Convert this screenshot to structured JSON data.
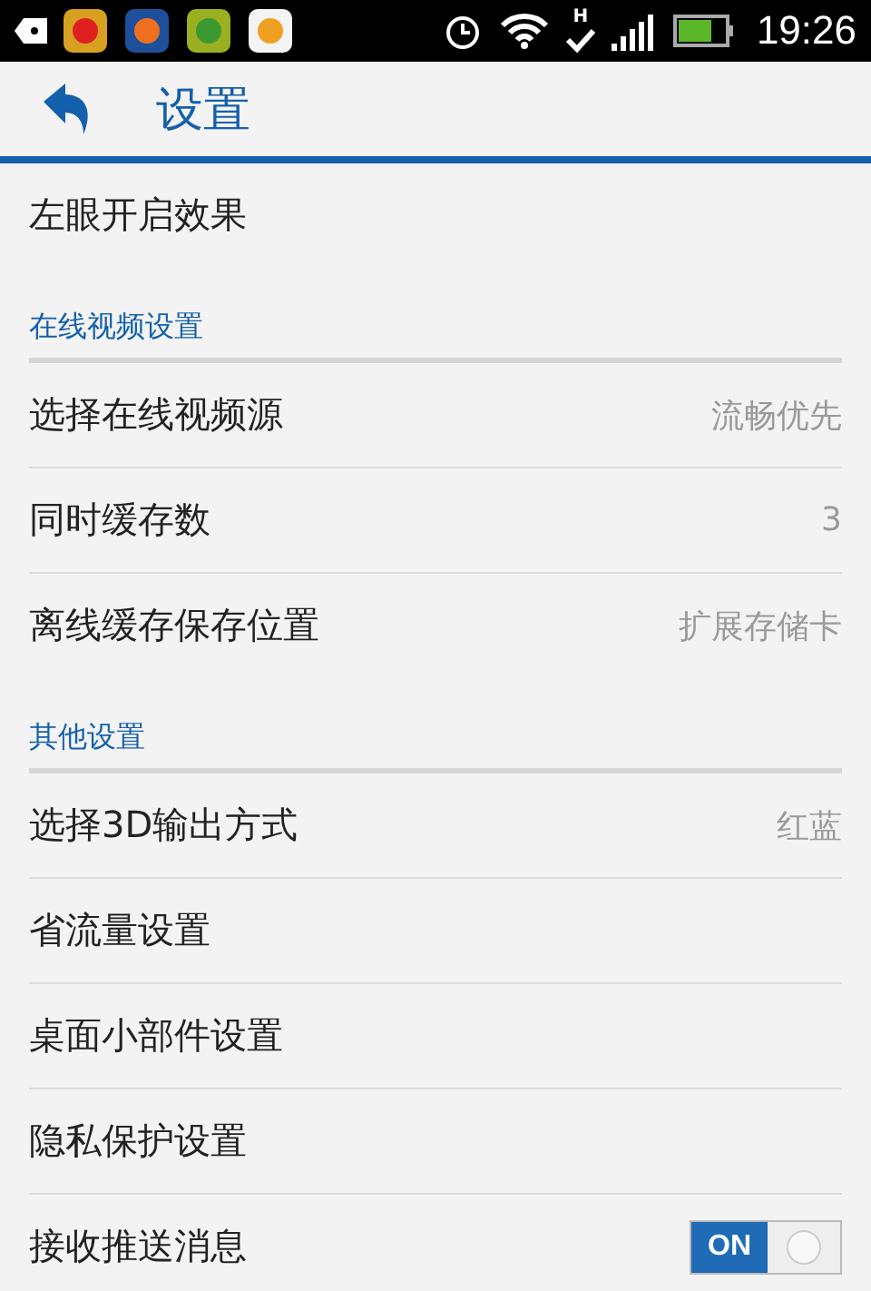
{
  "status_bar": {
    "network_label": "H",
    "time": "19:26"
  },
  "header": {
    "title": "设置"
  },
  "items": [
    {
      "kind": "row",
      "label": "左眼开启效果"
    },
    {
      "kind": "section",
      "label": "在线视频设置"
    },
    {
      "kind": "row",
      "label": "选择在线视频源",
      "value": "流畅优先"
    },
    {
      "kind": "row",
      "label": "同时缓存数",
      "value": "3"
    },
    {
      "kind": "row",
      "label": "离线缓存保存位置",
      "value": "扩展存储卡"
    },
    {
      "kind": "section",
      "label": "其他设置"
    },
    {
      "kind": "row",
      "label": "选择3D输出方式",
      "value": "红蓝"
    },
    {
      "kind": "row",
      "label": "省流量设置"
    },
    {
      "kind": "row",
      "label": "桌面小部件设置"
    },
    {
      "kind": "row",
      "label": "隐私保护设置"
    },
    {
      "kind": "toggle",
      "label": "接收推送消息",
      "on": true,
      "state_label": "ON"
    }
  ]
}
